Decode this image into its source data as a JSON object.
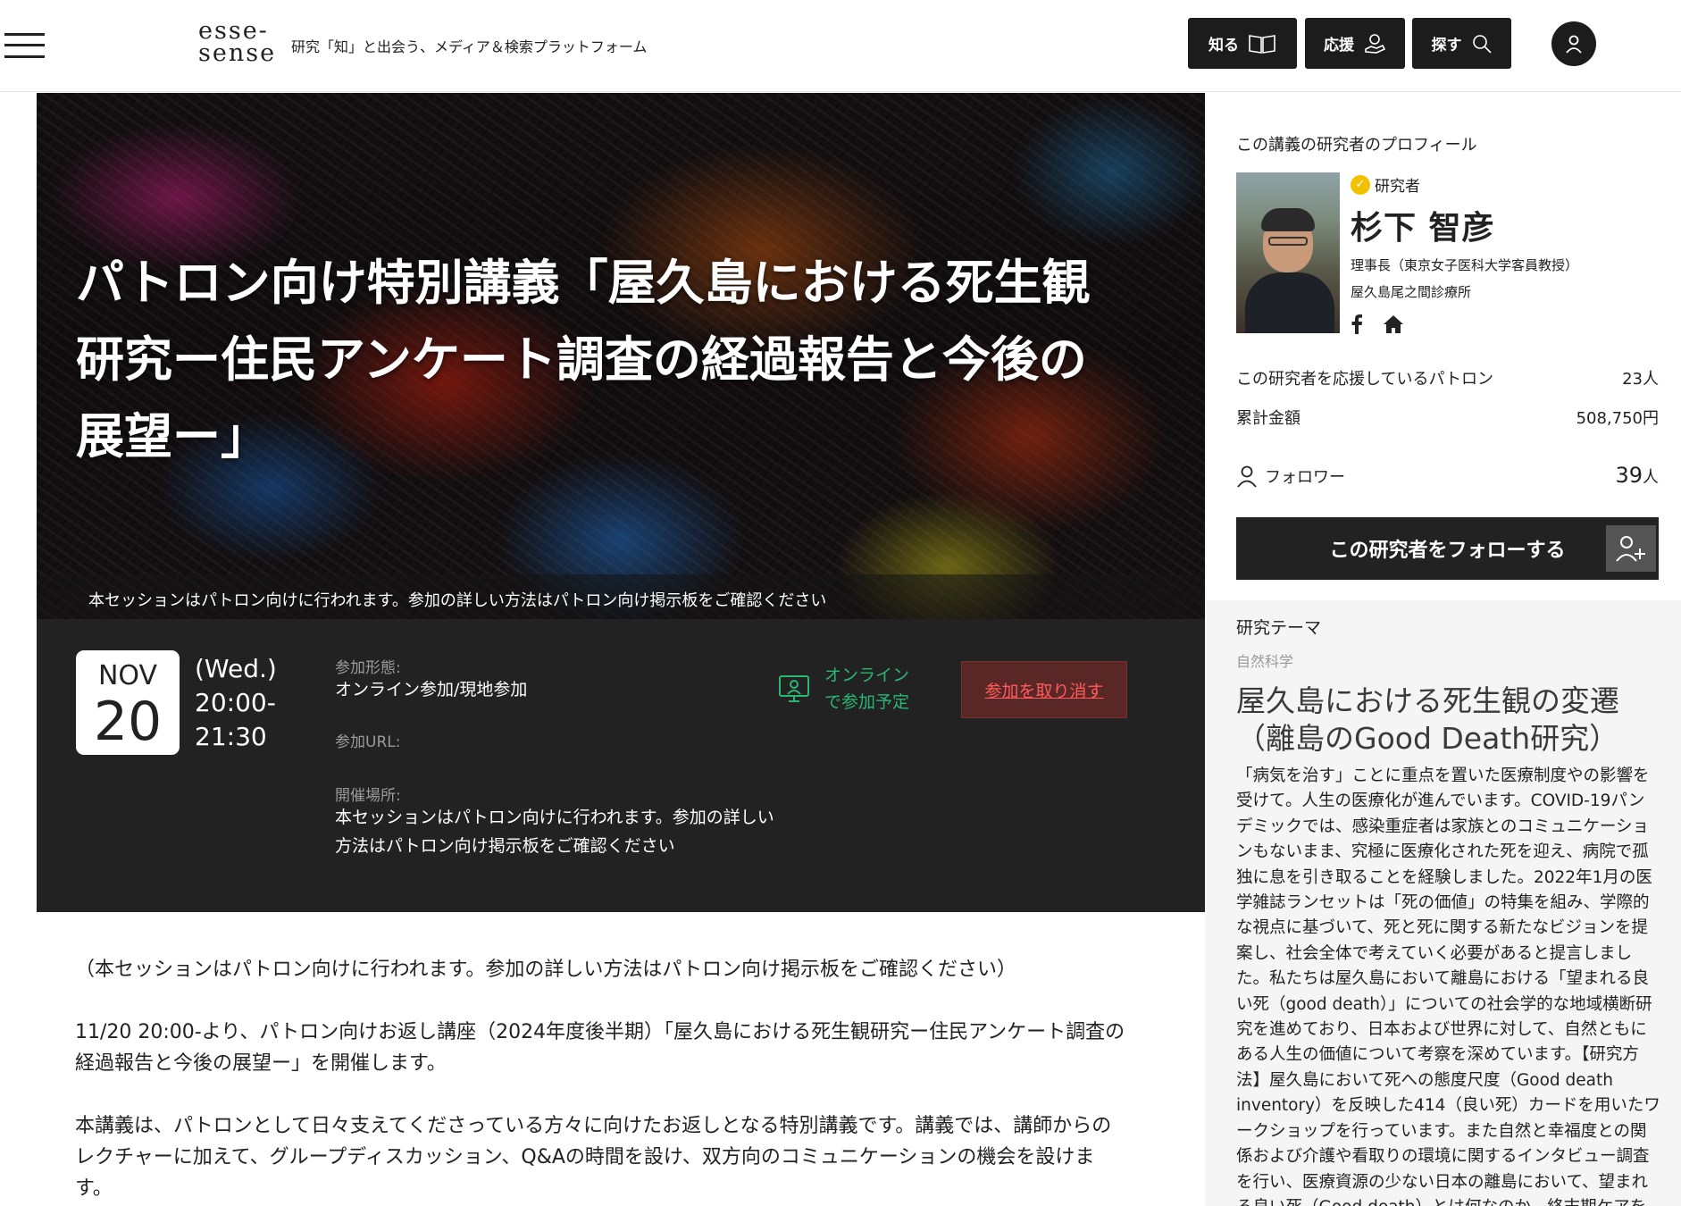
{
  "header": {
    "logo_line1": "esse-",
    "logo_line2": "sense",
    "tagline": "研究「知」と出会う、メディア＆検索プラットフォーム",
    "nav": [
      {
        "label": "知る"
      },
      {
        "label": "応援"
      },
      {
        "label": "探す"
      }
    ]
  },
  "hero": {
    "title": "パトロン向け特別講義「屋久島における死生観研究ー住民アンケート調査の経過報告と今後の展望ー」",
    "note": "本セッションはパトロン向けに行われます。参加の詳しい方法はパトロン向け掲示板をご確認ください"
  },
  "event": {
    "month": "NOV",
    "day": "20",
    "weekday": "(Wed.)",
    "time_start": "20:00-",
    "time_end": "21:30",
    "format_label": "参加形態:",
    "format_value": "オンライン参加/現地参加",
    "url_label": "参加URL:",
    "venue_label": "開催場所:",
    "venue_value": "本セッションはパトロン向けに行われます。参加の詳しい方法はパトロン向け掲示板をご確認ください",
    "online_line1": "オンライン",
    "online_line2": "で参加予定",
    "cancel_label": "参加を取り消す",
    "status_color": "#2bb673",
    "cancel_color": "#ff5a5a"
  },
  "body": {
    "p1": "（本セッションはパトロン向けに行われます。参加の詳しい方法はパトロン向け掲示板をご確認ください）",
    "p2": "11/20 20:00-より、パトロン向けお返し講座（2024年度後半期）「屋久島における死生観研究ー住民アンケート調査の経過報告と今後の展望ー」を開催します。",
    "p3": "本講義は、パトロンとして日々支えてくださっている方々に向けたお返しとなる特別講義です。講義では、講師からのレクチャーに加えて、グループディスカッション、Q&Aの時間を設け、双方向のコミュニケーションの機会を設けます。"
  },
  "sidebar": {
    "heading": "この講義の研究者のプロフィール",
    "badge": "研究者",
    "name": "杉下 智彦",
    "role1": "理事長（東京女子医科大学客員教授）",
    "role2": "屋久島尾之間診療所",
    "patrons_label": "この研究者を応援しているパトロン",
    "patrons_value": "23人",
    "total_label": "累計金額",
    "total_value": "508,750円",
    "followers_label": "フォロワー",
    "followers_count": "39",
    "followers_unit": "人",
    "follow_button": "この研究者をフォローする"
  },
  "theme": {
    "heading": "研究テーマ",
    "category": "自然科学",
    "title": "屋久島における死生観の変遷（離島のGood Death研究）",
    "description": "「病気を治す」ことに重点を置いた医療制度やの影響を受けて。人生の医療化が進んでいます。COVID-19パンデミックでは、感染重症者は家族とのコミュニケーションもないまま、究極に医療化された死を迎え、病院で孤独に息を引き取ることを経験しました。2022年1月の医学雑誌ランセットは「死の価値」の特集を組み、学際的な視点に基づいて、死と死に関する新たなビジョンを提案し、社会全体で考えていく必要があると提言しました。私たちは屋久島において離島における「望まれる良い死（good death）」についての社会学的な地域横断研究を進めており、日本および世界に対して、自然ともにある人生の価値について考察を深めています。【研究方法】屋久島において死への態度尺度（Good death inventory）を反映した414（良い死）カードを用いたワークショップを行っています。また自然と幸福度との関係および介護や看取りの環境に関するインタビュー調査を行い、医療資源の少ない日本の離島において、望まれる良い死（Good death）とは何なのか、終末期ケアを"
  }
}
